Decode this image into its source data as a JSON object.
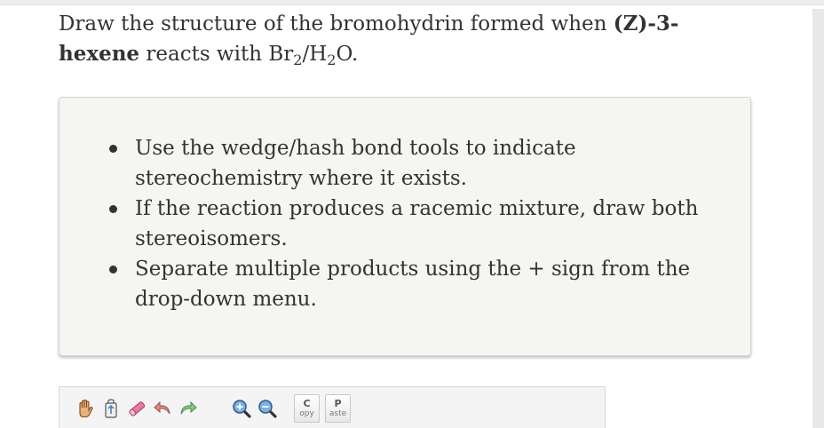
{
  "question": {
    "prefix": "Draw the structure of the bromohydrin formed when ",
    "compound": "(Z)-3-hexene",
    "middle": " reacts with Br",
    "sub1": "2",
    "slash": "/H",
    "sub2": "2",
    "suffix": "O."
  },
  "hints": [
    "Use the wedge/hash bond tools to indicate stereochemistry where it exists.",
    "If the reaction produces a racemic mixture, draw both stereoisomers.",
    "Separate multiple products using the + sign from the drop-down menu."
  ],
  "toolbar": {
    "icons": [
      "hand-icon",
      "lasso-icon",
      "eraser-icon",
      "undo-icon",
      "redo-icon",
      "zoom-in-icon",
      "zoom-out-icon"
    ],
    "copy": {
      "big": "C",
      "small": "opy"
    },
    "paste": {
      "big": "P",
      "small": "aste"
    }
  }
}
